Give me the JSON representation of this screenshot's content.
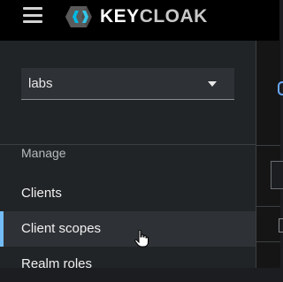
{
  "header": {
    "menu_icon": "hamburger-icon",
    "logo_text_a": "KEY",
    "logo_text_b": "CLOAK",
    "logo_icon": "keycloak-logo-icon"
  },
  "sidebar": {
    "realm_select": {
      "value": "labs",
      "icon": "caret-down-icon"
    },
    "section_title": "Manage",
    "items": [
      {
        "label": "Clients",
        "active": false
      },
      {
        "label": "Client scopes",
        "active": true
      },
      {
        "label": "Realm roles",
        "active": false
      }
    ]
  },
  "colors": {
    "topbar": "#000000",
    "sidebar": "#212427",
    "active_item": "#2e3135",
    "active_bar": "#73bcf7"
  }
}
